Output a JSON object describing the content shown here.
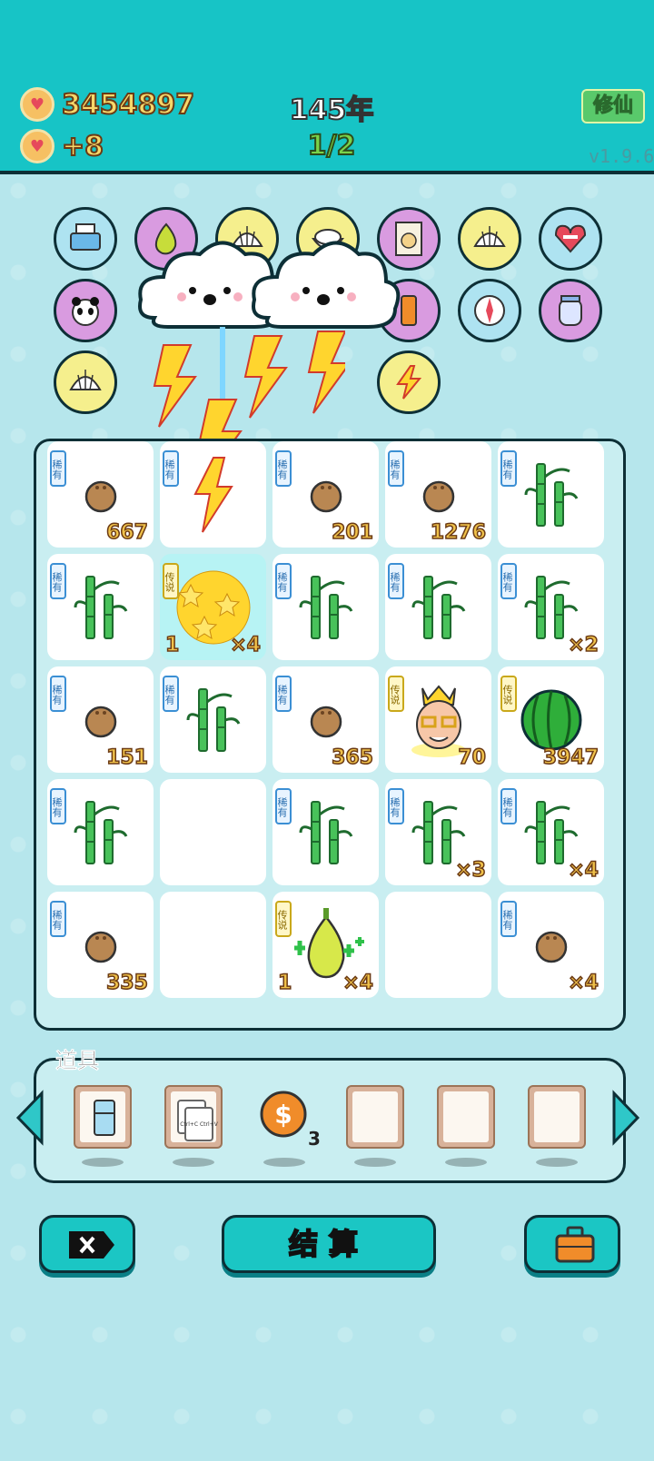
{
  "header": {
    "coins": "3454897",
    "income": "+8",
    "year": "145年",
    "round": "1/2",
    "cultivate_button": "修仙",
    "version": "v1.9.6"
  },
  "relics": [
    {
      "name": "printer-icon",
      "bg": "#aee3f1"
    },
    {
      "name": "pomelo-icon",
      "bg": "#d99be0"
    },
    {
      "name": "shell-icon",
      "bg": "#f5ef8d"
    },
    {
      "name": "rice-bowl-icon",
      "bg": "#f5ef8d"
    },
    {
      "name": "time-poster-icon",
      "bg": "#d99be0"
    },
    {
      "name": "shell-icon",
      "bg": "#f5ef8d"
    },
    {
      "name": "heart-fan-icon",
      "bg": "#aee3f1"
    },
    {
      "name": "panda-icon",
      "bg": "#d99be0"
    },
    {
      "name": "lamp-icon",
      "bg": "#d99be0"
    },
    {
      "name": "compass-icon",
      "bg": "#aee3f1"
    },
    {
      "name": "jar-icon",
      "bg": "#d99be0"
    },
    {
      "name": "shell-icon",
      "bg": "#f5ef8d"
    },
    {
      "name": "lightning-icon",
      "bg": "#f5ef8d"
    }
  ],
  "board": {
    "rare_tag": "稀有",
    "legend_tag": "传说",
    "cells": [
      {
        "item": "coconut",
        "tag": "rare",
        "value": "667"
      },
      {
        "item": "empty-fx",
        "tag": "rare",
        "value": ""
      },
      {
        "item": "coconut",
        "tag": "rare",
        "value": "201"
      },
      {
        "item": "coconut",
        "tag": "rare",
        "value": "1276"
      },
      {
        "item": "bamboo",
        "tag": "rare",
        "value": ""
      },
      {
        "item": "bamboo",
        "tag": "rare",
        "value": ""
      },
      {
        "item": "stars",
        "tag": "legend",
        "value": "×4",
        "left": "1"
      },
      {
        "item": "bamboo",
        "tag": "rare",
        "value": ""
      },
      {
        "item": "bamboo",
        "tag": "rare",
        "value": ""
      },
      {
        "item": "bamboo",
        "tag": "rare",
        "value": "×2"
      },
      {
        "item": "coconut",
        "tag": "rare",
        "value": "151"
      },
      {
        "item": "bamboo",
        "tag": "rare",
        "value": ""
      },
      {
        "item": "coconut",
        "tag": "rare",
        "value": "365"
      },
      {
        "item": "king",
        "tag": "legend",
        "value": "70"
      },
      {
        "item": "watermelon",
        "tag": "legend",
        "value": "3947"
      },
      {
        "item": "bamboo",
        "tag": "rare",
        "value": ""
      },
      {
        "item": "empty",
        "tag": "",
        "value": ""
      },
      {
        "item": "bamboo",
        "tag": "rare",
        "value": ""
      },
      {
        "item": "bamboo",
        "tag": "rare",
        "value": "×3"
      },
      {
        "item": "bamboo",
        "tag": "rare",
        "value": "×4"
      },
      {
        "item": "coconut",
        "tag": "rare",
        "value": "335"
      },
      {
        "item": "empty",
        "tag": "",
        "value": ""
      },
      {
        "item": "pear",
        "tag": "legend",
        "value": "×4",
        "left": "1"
      },
      {
        "item": "empty",
        "tag": "",
        "value": ""
      },
      {
        "item": "coconut",
        "tag": "rare",
        "value": "×4"
      }
    ]
  },
  "props": {
    "title": "道具",
    "coin_count": "3",
    "copy_paste_text": "Ctrl+C Ctrl+V"
  },
  "buttons": {
    "settle": "结算"
  },
  "colors": {
    "topbar": "#17c4c6",
    "background": "#b6e6ec",
    "button": "#1bc6c4"
  }
}
